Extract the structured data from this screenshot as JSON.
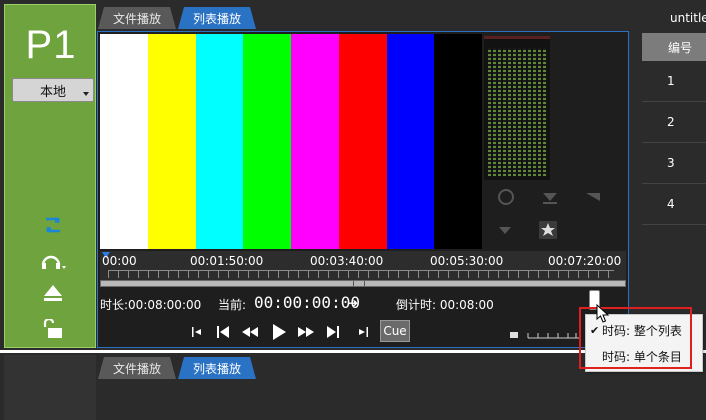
{
  "channel": {
    "label": "P1",
    "source_value": "本地"
  },
  "tabs": [
    {
      "label": "文件播放"
    },
    {
      "label": "列表播放"
    }
  ],
  "document_title": "untitle",
  "color_bars": [
    "#ffffff",
    "#ffff00",
    "#00ffff",
    "#00ff00",
    "#ff00ff",
    "#ff0000",
    "#0000ff",
    "#000000"
  ],
  "timeline": {
    "labels": [
      "00:00",
      "00:01:50:00",
      "00:03:40:00",
      "00:05:30:00",
      "00:07:20:00"
    ]
  },
  "info": {
    "duration": "时长:00:08:00:00",
    "current_label": "当前:",
    "current_value": "00:00:00:00",
    "countdown": "倒计时: 00:08:00"
  },
  "transport": {
    "cue_label": "Cue"
  },
  "list_panel": {
    "header": "编号",
    "rows": [
      "1",
      "2",
      "3",
      "4"
    ]
  },
  "context_menu": {
    "items": [
      {
        "label": "时码: 整个列表",
        "checked": true
      },
      {
        "label": "时码: 单个条目",
        "checked": false
      }
    ]
  },
  "lower_tabs": [
    {
      "label": "文件播放"
    },
    {
      "label": "列表播放"
    }
  ],
  "colors": {
    "left_panel": "#6ea33d",
    "accent": "#2a72c4",
    "highlight_box": "#e02020"
  },
  "icons": [
    "loop-icon",
    "headphones-icon",
    "eject-icon",
    "unlock-icon",
    "circle-icon",
    "triangle-down-icon",
    "star-icon",
    "skip-start-icon",
    "prev-icon",
    "rewind-icon",
    "play-icon",
    "forward-icon",
    "next-icon",
    "skip-end-icon",
    "arrow-right-icon",
    "cursor-icon"
  ]
}
